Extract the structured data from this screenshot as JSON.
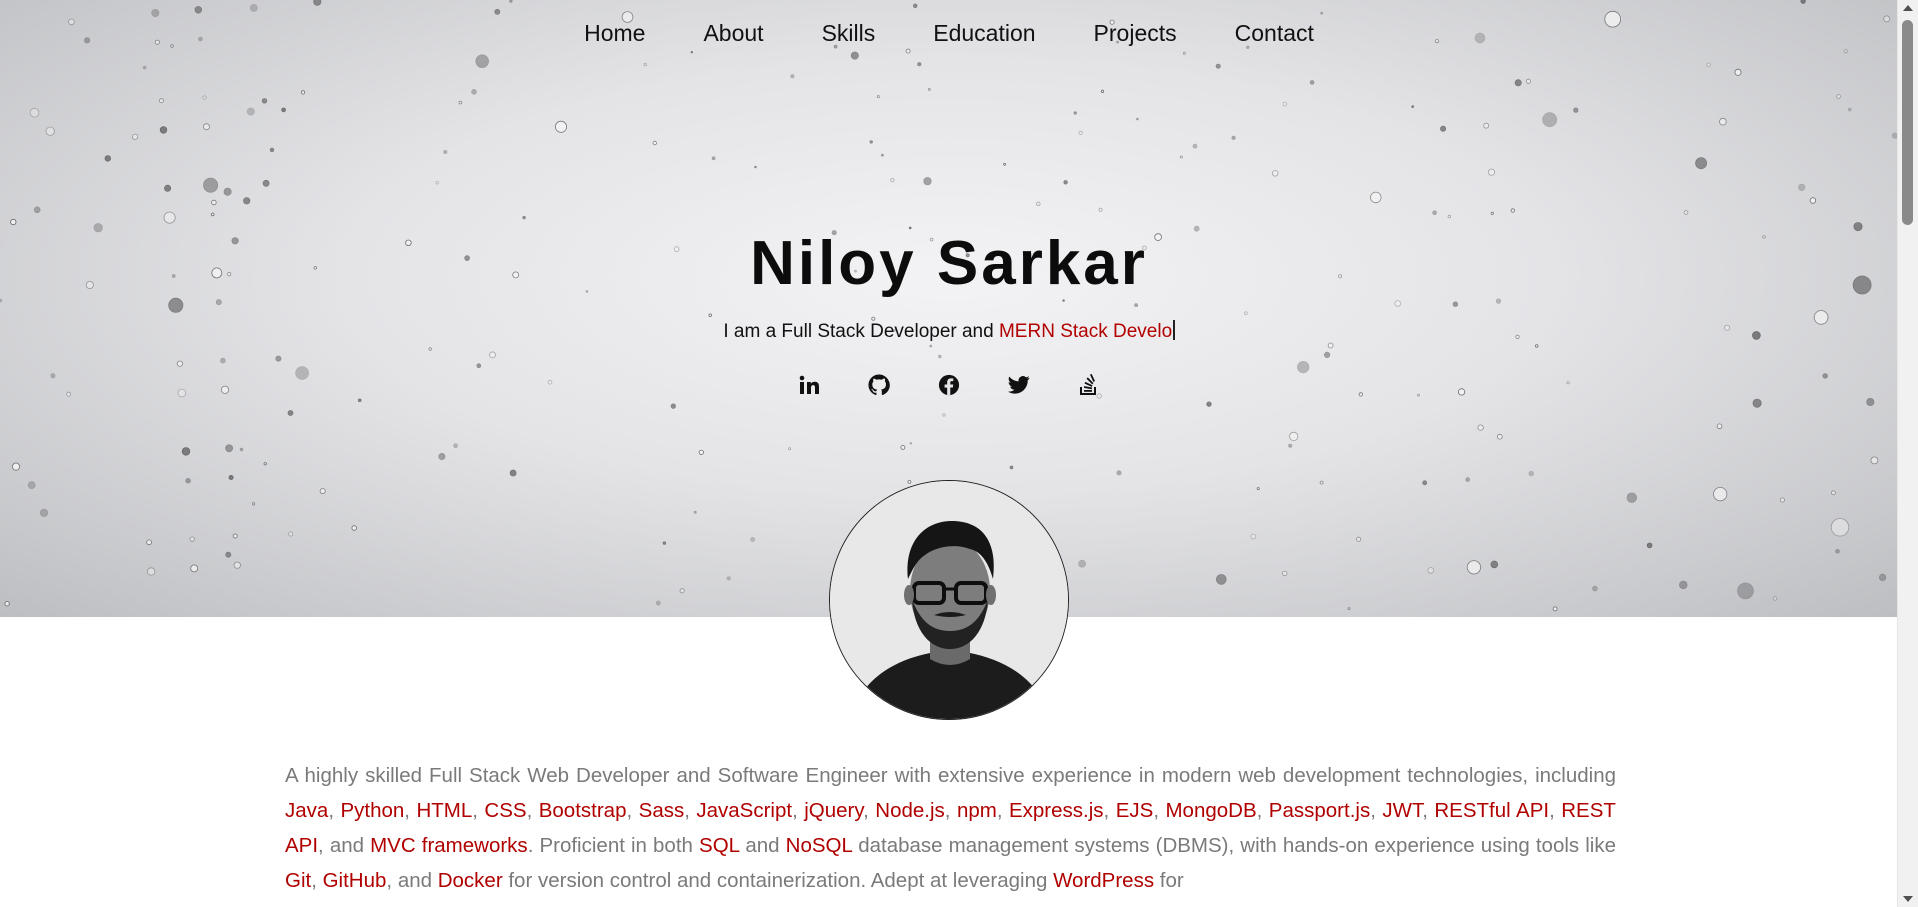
{
  "nav": {
    "items": [
      "Home",
      "About",
      "Skills",
      "Education",
      "Projects",
      "Contact"
    ]
  },
  "hero": {
    "name": "Niloy Sarkar",
    "tagline_prefix": "I am a Full Stack Developer and ",
    "tagline_typed": "MERN Stack Develo"
  },
  "social": {
    "icons": [
      "linkedin-icon",
      "github-icon",
      "facebook-icon",
      "twitter-icon",
      "stackoverflow-icon"
    ]
  },
  "profile": {
    "avatar_icon": "profile-photo"
  },
  "about": {
    "s1": "A highly skilled Full Stack Web Developer and Software Engineer with extensive experience in modern web development technologies, including ",
    "tech1": [
      "Java",
      "Python",
      "HTML",
      "CSS",
      "Bootstrap",
      "Sass",
      "JavaScript",
      "jQuery",
      "Node.js",
      "npm",
      "Express.js",
      "EJS",
      "MongoDB",
      "Passport.js",
      "JWT",
      "RESTful API",
      "REST API"
    ],
    "and1": ", and ",
    "mvc": "MVC frameworks",
    "s2": ". Proficient in both ",
    "sql": "SQL",
    "and2": " and ",
    "nosql": "NoSQL",
    "s3": " database management systems (DBMS), with hands-on experience using tools like ",
    "git": "Git",
    "comma": ", ",
    "github": "GitHub",
    "and3": ", and ",
    "docker": "Docker",
    "s4": " for version control and containerization. Adept at leveraging ",
    "wordpress": "WordPress",
    "s5": " for"
  },
  "colors": {
    "accent": "#b00000",
    "body_text": "#7a7a7a"
  }
}
